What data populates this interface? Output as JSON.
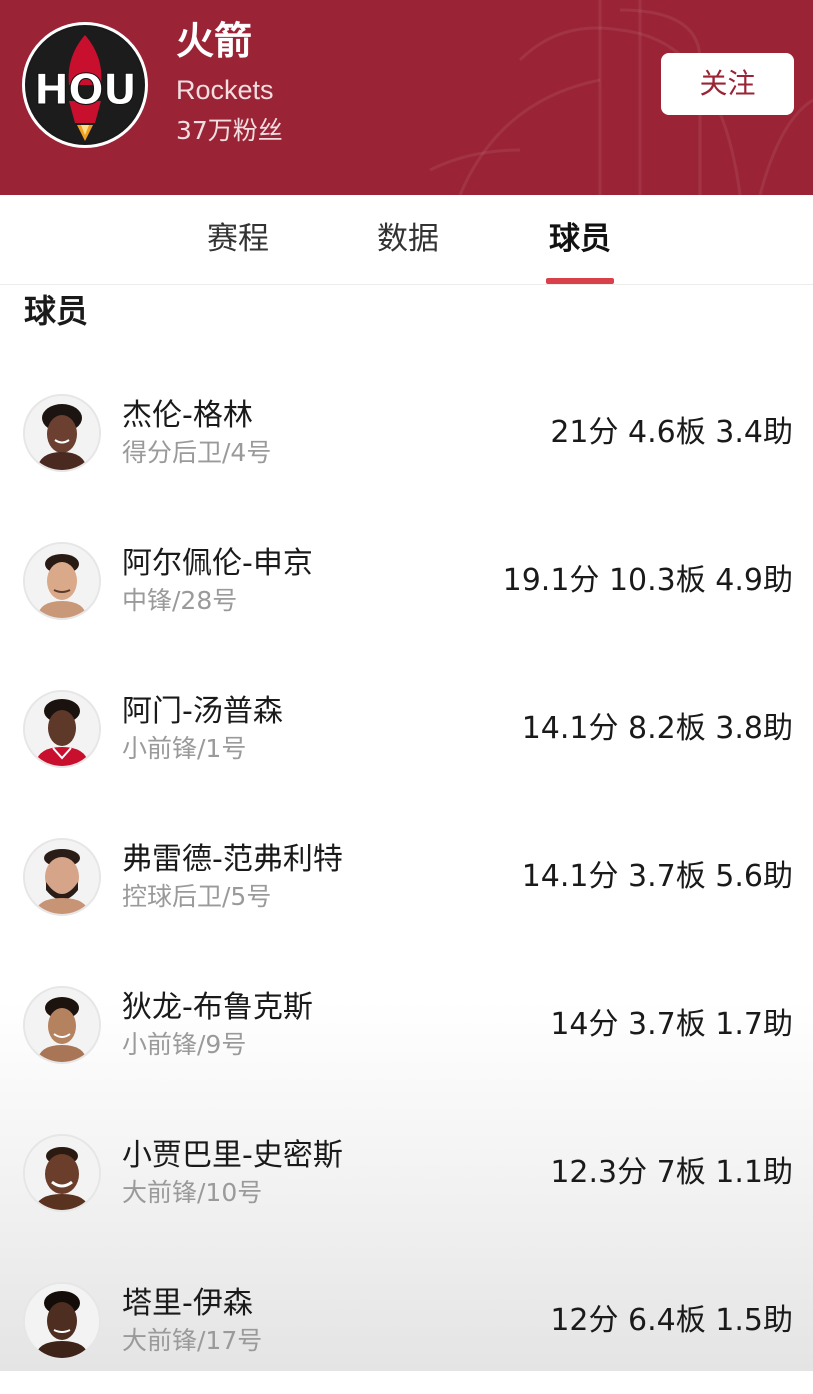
{
  "header": {
    "team_name": "火箭",
    "team_name_en": "Rockets",
    "followers": "37万粉丝",
    "logo_text": "HOU",
    "follow_label": "关注",
    "brand_color": "#9a2436"
  },
  "tabs": [
    {
      "label": "赛程",
      "active": false
    },
    {
      "label": "数据",
      "active": false
    },
    {
      "label": "球员",
      "active": true
    }
  ],
  "section": {
    "title": "球员"
  },
  "players": [
    {
      "name": "杰伦-格林",
      "position": "得分后卫/4号",
      "stats": "21分 4.6板 3.4助"
    },
    {
      "name": "阿尔佩伦-申京",
      "position": "中锋/28号",
      "stats": "19.1分 10.3板 4.9助"
    },
    {
      "name": "阿门-汤普森",
      "position": "小前锋/1号",
      "stats": "14.1分 8.2板 3.8助"
    },
    {
      "name": "弗雷德-范弗利特",
      "position": "控球后卫/5号",
      "stats": "14.1分 3.7板 5.6助"
    },
    {
      "name": "狄龙-布鲁克斯",
      "position": "小前锋/9号",
      "stats": "14分 3.7板 1.7助"
    },
    {
      "name": "小贾巴里-史密斯",
      "position": "大前锋/10号",
      "stats": "12.3分 7板 1.1助"
    },
    {
      "name": "塔里-伊森",
      "position": "大前锋/17号",
      "stats": "12分 6.4板 1.5助"
    }
  ]
}
